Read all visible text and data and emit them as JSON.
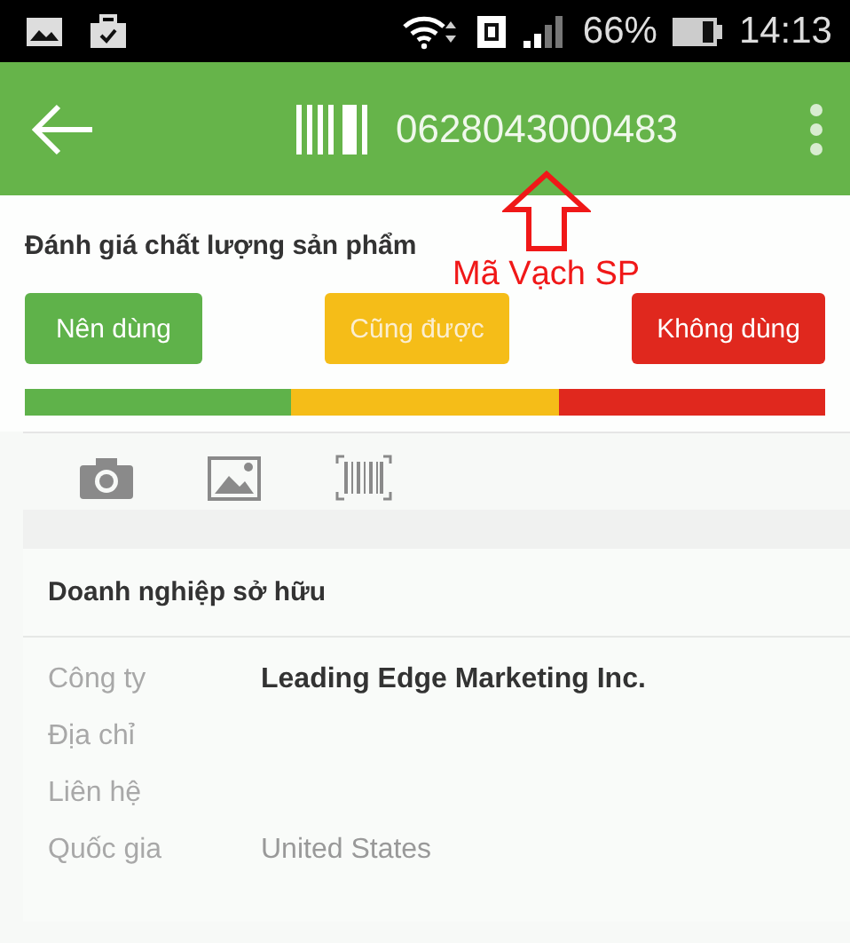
{
  "status_bar": {
    "battery_text": "66%",
    "time": "14:13"
  },
  "app_bar": {
    "barcode": "0628043000483"
  },
  "annotation": {
    "text": "Mã Vạch SP"
  },
  "rating": {
    "title": "Đánh giá chất lượng sản phẩm",
    "options": [
      {
        "label": "Nên dùng",
        "color": "#5fb24a"
      },
      {
        "label": "Cũng được",
        "color": "#f5bd18"
      },
      {
        "label": "Không dùng",
        "color": "#e0281e"
      }
    ]
  },
  "owner": {
    "title": "Doanh nghiệp sở hữu",
    "rows": [
      {
        "label": "Công ty",
        "value": "Leading Edge Marketing Inc.",
        "bold": true
      },
      {
        "label": "Địa chỉ"
      },
      {
        "label": "Liên hệ"
      },
      {
        "label": "Quốc gia",
        "value": "United States",
        "bold": false
      }
    ]
  }
}
